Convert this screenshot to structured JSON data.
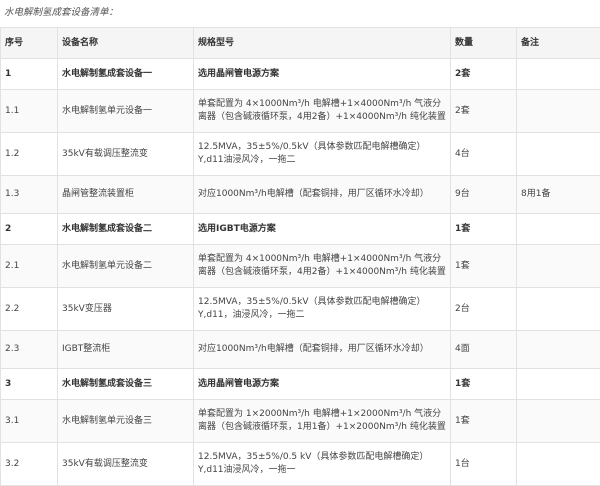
{
  "caption": "水电解制氢成套设备清单：",
  "headers": [
    "序号",
    "设备名称",
    "规格型号",
    "数量",
    "备注"
  ],
  "rows": [
    {
      "type": "group",
      "no": "1",
      "name": "水电解制氢成套设备一",
      "spec": "选用晶闸管电源方案",
      "qty": "2套",
      "note": ""
    },
    {
      "type": "item",
      "no": "1.1",
      "name": "水电解制氢单元设备一",
      "spec": "单套配置为 4×1000Nm³/h 电解槽+1×4000Nm³/h 气液分离器（包含碱液循环泵，4用2备）+1×4000Nm³/h 纯化装置",
      "qty": "2套",
      "note": ""
    },
    {
      "type": "item",
      "no": "1.2",
      "name": "35kV有载调压整流变",
      "spec": "12.5MVA，35±5%/0.5kV（具体参数匹配电解槽确定） Y,d11油浸风冷，一拖二",
      "qty": "4台",
      "note": ""
    },
    {
      "type": "item",
      "no": "1.3",
      "name": "晶闸管整流装置柜",
      "spec": "对应1000Nm³/h电解槽（配套铜排，用厂区循环水冷却）",
      "qty": "9台",
      "note": "8用1备"
    },
    {
      "type": "group",
      "no": "2",
      "name": "水电解制氢成套设备二",
      "spec": "选用IGBT电源方案",
      "qty": "1套",
      "note": ""
    },
    {
      "type": "item",
      "no": "2.1",
      "name": "水电解制氢单元设备二",
      "spec": "单套配置为 4×1000Nm³/h 电解槽+1×4000Nm³/h 气液分离器（包含碱液循环泵，4用2备）+1×4000Nm³/h 纯化装置",
      "qty": "1套",
      "note": ""
    },
    {
      "type": "item",
      "no": "2.2",
      "name": "35kV变压器",
      "spec": "12.5MVA，35±5%/0.5kV（具体参数匹配电解槽确定） Y,d11，油浸风冷，一拖二",
      "qty": "2台",
      "note": ""
    },
    {
      "type": "item",
      "no": "2.3",
      "name": "IGBT整流柜",
      "spec": "对应1000Nm³/h电解槽（配套铜排，用厂区循环水冷却）",
      "qty": "4面",
      "note": ""
    },
    {
      "type": "group",
      "no": "3",
      "name": "水电解制氢成套设备三",
      "spec": "选用晶闸管电源方案",
      "qty": "1套",
      "note": ""
    },
    {
      "type": "item",
      "no": "3.1",
      "name": "水电解制氢单元设备三",
      "spec": "单套配置为 1×2000Nm³/h 电解槽+1×2000Nm³/h 气液分离器（包含碱液循环泵，1用1备）+1×2000Nm³/h 纯化装置",
      "qty": "1套",
      "note": ""
    },
    {
      "type": "item",
      "no": "3.2",
      "name": "35kV有载调压整流变",
      "spec": "12.5MVA，35±5%/0.5 kV（具体参数匹配电解槽确定） Y,d11油浸风冷，一拖一",
      "qty": "1台",
      "note": ""
    }
  ]
}
